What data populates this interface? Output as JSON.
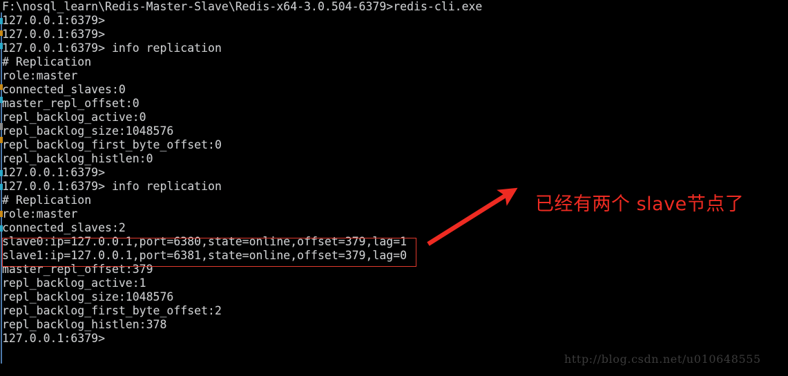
{
  "window": {
    "background_color": "#000000",
    "text_color": "#cdcdcd",
    "accent_color": "#e23a2e"
  },
  "terminal": {
    "lines": [
      "F:\\nosql_learn\\Redis-Master-Slave\\Redis-x64-3.0.504-6379>redis-cli.exe",
      "127.0.0.1:6379>",
      "127.0.0.1:6379>",
      "127.0.0.1:6379> info replication",
      "# Replication",
      "role:master",
      "connected_slaves:0",
      "master_repl_offset:0",
      "repl_backlog_active:0",
      "repl_backlog_size:1048576",
      "repl_backlog_first_byte_offset:0",
      "repl_backlog_histlen:0",
      "127.0.0.1:6379>",
      "127.0.0.1:6379> info replication",
      "# Replication",
      "role:master",
      "connected_slaves:2",
      "slave0:ip=127.0.0.1,port=6380,state=online,offset=379,lag=1",
      "slave1:ip=127.0.0.1,port=6381,state=online,offset=379,lag=0",
      "master_repl_offset:379",
      "repl_backlog_active:1",
      "repl_backlog_size:1048576",
      "repl_backlog_first_byte_offset:2",
      "repl_backlog_histlen:378",
      "127.0.0.1:6379>"
    ],
    "prompt": "127.0.0.1:6379>",
    "working_directory": "F:\\nosql_learn\\Redis-Master-Slave\\Redis-x64-3.0.504-6379",
    "command_run": "redis-cli.exe",
    "redis_command": "info replication"
  },
  "annotation": {
    "text": "已经有两个 slave节点了",
    "color": "#ee2b22",
    "arrow_color": "#ee2b22",
    "highlight_box_color": "#e23a2e",
    "highlighted_lines": [
      "slave0:ip=127.0.0.1,port=6380,state=online,offset=379,lag=1",
      "slave1:ip=127.0.0.1,port=6381,state=online,offset=379,lag=0"
    ]
  },
  "watermark": {
    "text": "http://blog.csdn.net/u010648555"
  }
}
